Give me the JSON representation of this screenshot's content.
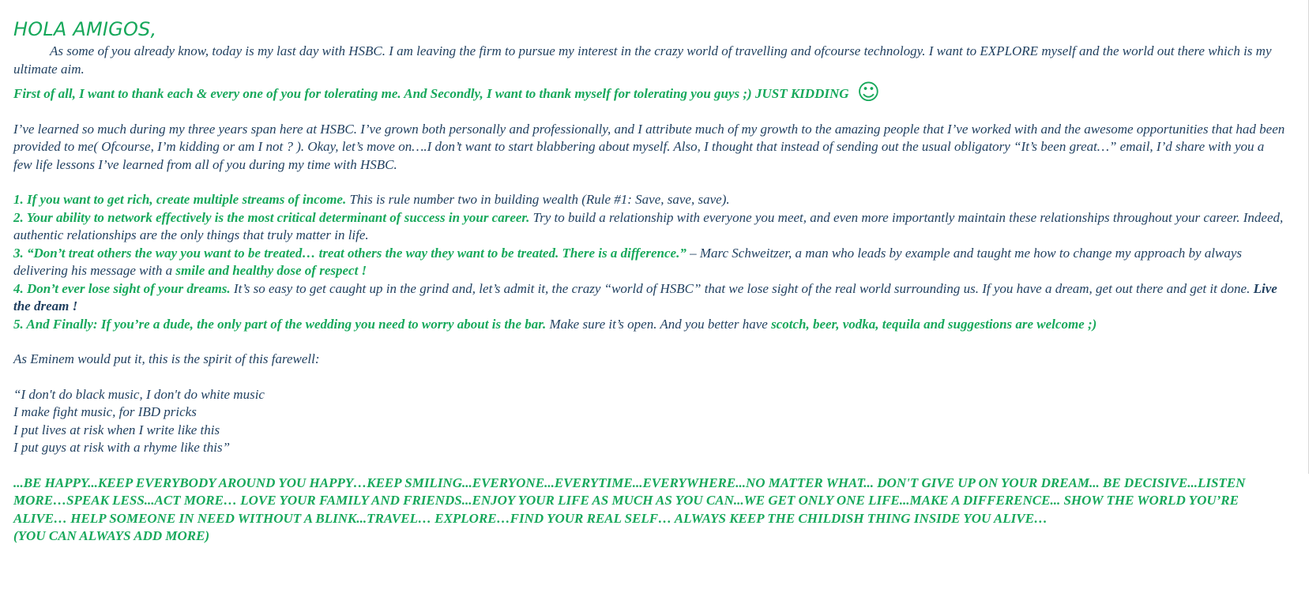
{
  "heading": "HOLA AMIGOS,",
  "intro": "As some of you already know, today is my last day with HSBC. I am leaving the firm to pursue my interest in the crazy world of travelling and ofcourse technology. I want to EXPLORE myself and the world out there which is my ultimate aim.",
  "thanks": {
    "text": "First of all, I want to thank each & every one of you for tolerating me. And Secondly, I want to thank myself for tolerating you guys ;)  JUST KIDDING",
    "emoji": "☺"
  },
  "learned": "I’ve learned so much during my three years span here at HSBC. I’ve grown both personally and professionally, and I attribute much of my growth to the amazing people that I’ve worked with and the awesome opportunities that had been provided to me( Ofcourse, I’m kidding or am I not ? ). Okay, let’s move on….I don’t want to start blabbering about myself. Also, I thought that instead of sending out the usual obligatory “It’s been great…” email, I’d share with you a few life lessons I’ve learned from all of you during my time with HSBC.",
  "lessons": [
    {
      "bold": "1. If you want to get rich, create multiple streams of income.",
      "rest": " This is rule number two in building wealth (Rule #1: Save, save, save)."
    },
    {
      "bold": "2. Your ability to network effectively is the most critical determinant of success in your career.",
      "rest": " Try to build a relationship with everyone you meet, and even more importantly maintain these relationships throughout your career. Indeed, authentic relationships are the only things that truly matter in life."
    },
    {
      "bold": "3. “Don’t treat others the way you want to be treated… treat others the way they want to be treated. There is a difference.”",
      "rest": " – Marc Schweitzer, a man who leads by example and taught me how to change my approach by always delivering his message with a ",
      "tail_green": "smile and healthy dose of respect !"
    },
    {
      "bold": "4. Don’t ever lose sight of your dreams.",
      "rest": " It’s so easy to get caught up in the grind and, let’s admit it, the crazy “world of HSBC” that we lose sight of the real world surrounding us. If you have a dream, get out there and get it done. ",
      "tail_dark": "Live the dream !"
    },
    {
      "bold": "5. And Finally: If you’re a dude, the only part of the wedding you need to worry about is the bar.",
      "rest": " Make sure it’s open. And you better have  ",
      "tail_green": "scotch, beer, vodka, tequila and suggestions are welcome ;)"
    }
  ],
  "eminem_intro": "As Eminem would put it, this is the spirit of this farewell:",
  "lyrics": [
    "“I don't do black music, I don't do white music",
    "I make fight music, for IBD pricks",
    "I put lives at risk when I write like this",
    "I put guys at risk with a rhyme like this”"
  ],
  "closing": "...BE HAPPY...KEEP EVERYBODY AROUND YOU HAPPY…KEEP SMILING...EVERYONE...EVERYTIME...EVERYWHERE...NO MATTER WHAT... DON'T GIVE UP ON YOUR DREAM... BE DECISIVE...LISTEN MORE…SPEAK LESS...ACT MORE… LOVE YOUR FAMILY AND FRIENDS...ENJOY YOUR LIFE AS MUCH AS YOU CAN...WE GET ONLY ONE LIFE...MAKE A DIFFERENCE... SHOW THE WORLD YOU’RE ALIVE… HELP SOMEONE IN NEED WITHOUT A BLINK...TRAVEL… EXPLORE…FIND YOUR REAL SELF… ALWAYS KEEP THE CHILDISH THING INSIDE YOU ALIVE…",
  "closing_note": "(YOU CAN ALWAYS ADD MORE)",
  "colors": {
    "accent_green": "#17a85b",
    "body_text": "#1f3f5f"
  }
}
